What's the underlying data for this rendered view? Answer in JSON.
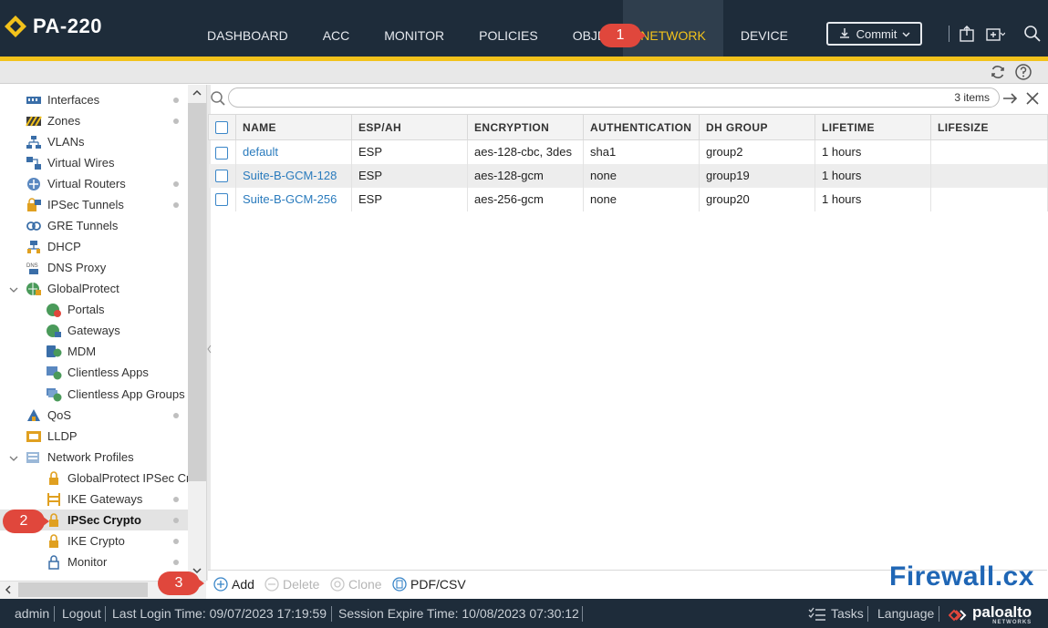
{
  "app": {
    "device_name": "PA-220"
  },
  "nav": {
    "tabs": [
      {
        "label": "DASHBOARD"
      },
      {
        "label": "ACC"
      },
      {
        "label": "MONITOR"
      },
      {
        "label": "POLICIES"
      },
      {
        "label": "OBJE"
      },
      {
        "label": "NETWORK"
      },
      {
        "label": "DEVICE"
      }
    ],
    "commit_label": "Commit"
  },
  "sidebar": {
    "items": [
      {
        "label": "Interfaces"
      },
      {
        "label": "Zones"
      },
      {
        "label": "VLANs"
      },
      {
        "label": "Virtual Wires"
      },
      {
        "label": "Virtual Routers"
      },
      {
        "label": "IPSec Tunnels"
      },
      {
        "label": "GRE Tunnels"
      },
      {
        "label": "DHCP"
      },
      {
        "label": "DNS Proxy"
      },
      {
        "label": "GlobalProtect"
      },
      {
        "label": "Portals"
      },
      {
        "label": "Gateways"
      },
      {
        "label": "MDM"
      },
      {
        "label": "Clientless Apps"
      },
      {
        "label": "Clientless App Groups"
      },
      {
        "label": "QoS"
      },
      {
        "label": "LLDP"
      },
      {
        "label": "Network Profiles"
      },
      {
        "label": "GlobalProtect IPSec Cry"
      },
      {
        "label": "IKE Gateways"
      },
      {
        "label": "IPSec Crypto"
      },
      {
        "label": "IKE Crypto"
      },
      {
        "label": "Monitor"
      }
    ],
    "icon_texts": {
      "dns": "DNS"
    }
  },
  "main": {
    "search": {
      "placeholder": "",
      "count": "3 items"
    },
    "columns": [
      "NAME",
      "ESP/AH",
      "ENCRYPTION",
      "AUTHENTICATION",
      "DH GROUP",
      "LIFETIME",
      "LIFESIZE"
    ],
    "rows": [
      {
        "name": "default",
        "esp_ah": "ESP",
        "encryption": "aes-128-cbc, 3des",
        "authentication": "sha1",
        "dh_group": "group2",
        "lifetime": "1 hours",
        "lifesize": ""
      },
      {
        "name": "Suite-B-GCM-128",
        "esp_ah": "ESP",
        "encryption": "aes-128-gcm",
        "authentication": "none",
        "dh_group": "group19",
        "lifetime": "1 hours",
        "lifesize": ""
      },
      {
        "name": "Suite-B-GCM-256",
        "esp_ah": "ESP",
        "encryption": "aes-256-gcm",
        "authentication": "none",
        "dh_group": "group20",
        "lifetime": "1 hours",
        "lifesize": ""
      }
    ],
    "actions": {
      "add": "Add",
      "delete": "Delete",
      "clone": "Clone",
      "pdf_csv": "PDF/CSV"
    }
  },
  "watermark": "Firewall.cx",
  "callouts": {
    "one": "1",
    "two": "2",
    "three": "3"
  },
  "status": {
    "user": "admin",
    "logout": "Logout",
    "last_login": "Last Login Time: 09/07/2023 17:19:59",
    "session_expire": "Session Expire Time: 10/08/2023 07:30:12",
    "tasks": "Tasks",
    "language": "Language",
    "vendor_logo": "paloalto",
    "vendor_sub": "NETWORKS"
  },
  "colors": {
    "header_bg": "#1e2c3a",
    "accent_yellow": "#f2c21b",
    "link_blue": "#2a7bbd",
    "callout_red": "#e0473c"
  }
}
